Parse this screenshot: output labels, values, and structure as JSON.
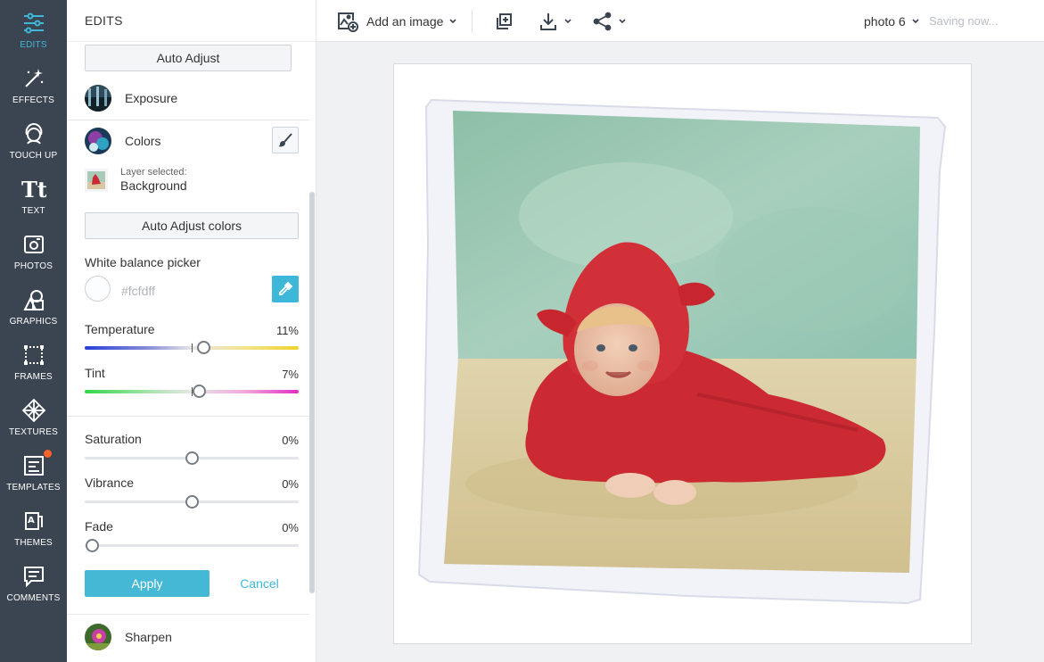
{
  "rail": {
    "items": [
      {
        "label": "EDITS",
        "icon": "sliders-icon",
        "active": true
      },
      {
        "label": "EFFECTS",
        "icon": "magic-wand-icon"
      },
      {
        "label": "TOUCH UP",
        "icon": "face-icon"
      },
      {
        "label": "TEXT",
        "icon": "text-icon"
      },
      {
        "label": "PHOTOS",
        "icon": "camera-icon"
      },
      {
        "label": "GRAPHICS",
        "icon": "shapes-icon"
      },
      {
        "label": "FRAMES",
        "icon": "frame-icon"
      },
      {
        "label": "TEXTURES",
        "icon": "texture-icon"
      },
      {
        "label": "TEMPLATES",
        "icon": "template-icon",
        "badge": true
      },
      {
        "label": "THEMES",
        "icon": "themes-icon"
      },
      {
        "label": "COMMENTS",
        "icon": "comment-icon"
      }
    ],
    "active_color": "#3eb7d8",
    "badge_color": "#f5632a"
  },
  "panel": {
    "title": "EDITS",
    "auto_adjust_label": "Auto Adjust",
    "exposure_label": "Exposure",
    "colors_label": "Colors",
    "layer_selected_label": "Layer selected:",
    "layer_name": "Background",
    "auto_adjust_colors_label": "Auto Adjust colors",
    "white_balance_label": "White balance picker",
    "white_balance_hex": "#fcfdff",
    "sliders": {
      "temperature": {
        "label": "Temperature",
        "value": "11%",
        "fraction": 0.555
      },
      "tint": {
        "label": "Tint",
        "value": "7%",
        "fraction": 0.535
      },
      "saturation": {
        "label": "Saturation",
        "value": "0%",
        "fraction": 0.5
      },
      "vibrance": {
        "label": "Vibrance",
        "value": "0%",
        "fraction": 0.5
      },
      "fade": {
        "label": "Fade",
        "value": "0%",
        "fraction": 0.0
      }
    },
    "apply_label": "Apply",
    "cancel_label": "Cancel",
    "sharpen_label": "Sharpen"
  },
  "topbar": {
    "add_image_label": "Add an image",
    "document_name": "photo 6",
    "status": "Saving now..."
  },
  "colors": {
    "accent": "#3eb7d8",
    "rail_bg": "#3b4451"
  }
}
